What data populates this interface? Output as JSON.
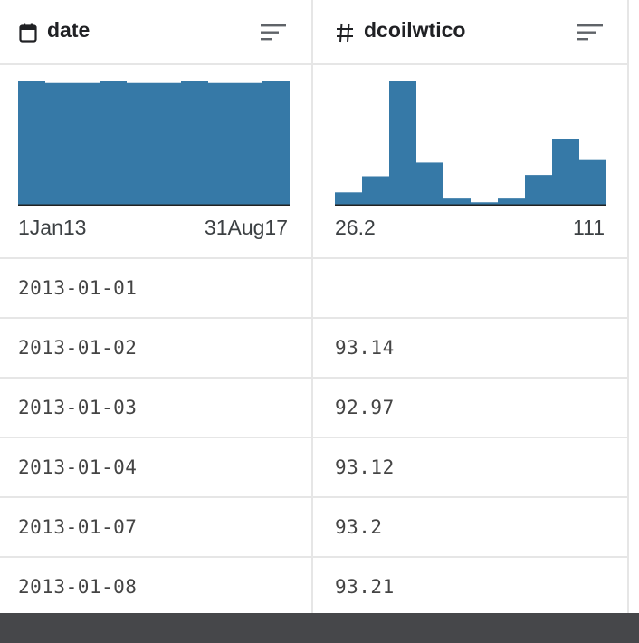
{
  "columns": [
    {
      "name": "date",
      "type_icon": "calendar-icon",
      "range_min": "1Jan13",
      "range_max": "31Aug17"
    },
    {
      "name": "dcoilwtico",
      "type_icon": "hash-icon",
      "range_min": "26.2",
      "range_max": "111"
    }
  ],
  "rows": [
    {
      "date": "2013-01-01",
      "dcoilwtico": ""
    },
    {
      "date": "2013-01-02",
      "dcoilwtico": "93.14"
    },
    {
      "date": "2013-01-03",
      "dcoilwtico": "92.97"
    },
    {
      "date": "2013-01-04",
      "dcoilwtico": "93.12"
    },
    {
      "date": "2013-01-07",
      "dcoilwtico": "93.2"
    },
    {
      "date": "2013-01-08",
      "dcoilwtico": "93.21"
    }
  ],
  "colors": {
    "bar": "#3679a7",
    "baseline": "#222222",
    "grid": "#e6e6e6",
    "footer": "#46474a"
  },
  "chart_data": [
    {
      "type": "bar",
      "column": "date",
      "values": [
        100,
        98,
        98,
        100,
        98,
        98,
        100,
        98,
        98,
        100
      ],
      "xlim": [
        "1Jan13",
        "31Aug17"
      ]
    },
    {
      "type": "bar",
      "column": "dcoilwtico",
      "values": [
        10,
        23,
        100,
        34,
        5,
        2,
        5,
        24,
        53,
        36
      ],
      "xlim": [
        "26.2",
        "111"
      ]
    }
  ]
}
